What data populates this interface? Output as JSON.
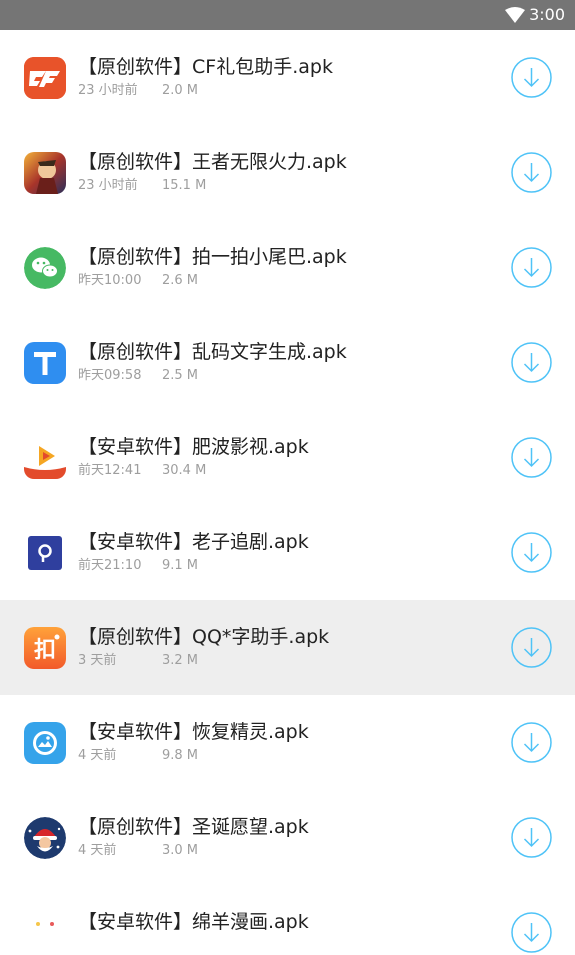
{
  "status_bar": {
    "time": "3:00",
    "wifi_icon": "wifi-icon"
  },
  "colors": {
    "status_bar_bg": "#757575",
    "accent": "#4fc3f7",
    "title": "#222222",
    "meta": "#9e9e9e",
    "highlight_row": "#eeeeee"
  },
  "files": [
    {
      "name": "【原创软件】CF礼包助手.apk",
      "date": "23 小时前",
      "size": "2.0 M",
      "icon": "cf-icon"
    },
    {
      "name": "【原创软件】王者无限火力.apk",
      "date": "23 小时前",
      "size": "15.1 M",
      "icon": "honor-of-kings-icon"
    },
    {
      "name": "【原创软件】拍一拍小尾巴.apk",
      "date": "昨天10:00",
      "size": "2.6 M",
      "icon": "wechat-icon"
    },
    {
      "name": "【原创软件】乱码文字生成.apk",
      "date": "昨天09:58",
      "size": "2.5 M",
      "icon": "text-t-icon"
    },
    {
      "name": "【安卓软件】肥波影视.apk",
      "date": "前天12:41",
      "size": "30.4 M",
      "icon": "video-play-icon"
    },
    {
      "name": "【安卓软件】老子追剧.apk",
      "date": "前天21:10",
      "size": "9.1 M",
      "icon": "location-pin-icon"
    },
    {
      "name": "【原创软件】QQ*字助手.apk",
      "date": "3 天前",
      "size": "3.2 M",
      "icon": "char-assistant-icon"
    },
    {
      "name": "【安卓软件】恢复精灵.apk",
      "date": "4 天前",
      "size": "9.8 M",
      "icon": "photo-recovery-icon"
    },
    {
      "name": "【原创软件】圣诞愿望.apk",
      "date": "4 天前",
      "size": "3.0 M",
      "icon": "santa-icon"
    },
    {
      "name": "【安卓软件】绵羊漫画.apk",
      "date": "",
      "size": "",
      "icon": "sheep-comic-icon"
    }
  ],
  "download_icon": "download-icon"
}
